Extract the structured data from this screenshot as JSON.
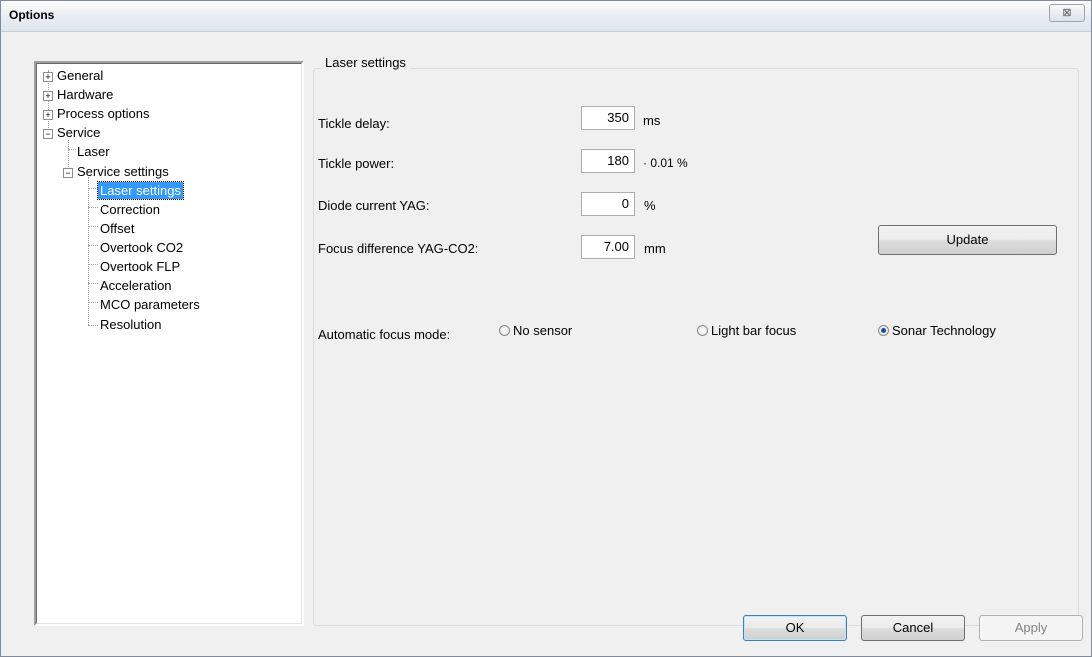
{
  "window": {
    "title": "Options",
    "close_glyph": "⊠"
  },
  "tree": {
    "nodes": [
      {
        "label": "General",
        "expander": "+"
      },
      {
        "label": "Hardware",
        "expander": "+"
      },
      {
        "label": "Process options",
        "expander": "+"
      },
      {
        "label": "Service",
        "expander": "−"
      },
      {
        "label": "Laser"
      },
      {
        "label": "Service settings",
        "expander": "−"
      },
      {
        "label": "Laser settings",
        "selected": true
      },
      {
        "label": "Correction"
      },
      {
        "label": "Offset"
      },
      {
        "label": "Overtook CO2"
      },
      {
        "label": "Overtook FLP"
      },
      {
        "label": "Acceleration"
      },
      {
        "label": "MCO parameters"
      },
      {
        "label": "Resolution"
      }
    ]
  },
  "panel": {
    "title": "Laser settings",
    "fields": [
      {
        "label": "Tickle delay:",
        "value": "350",
        "unit": "ms"
      },
      {
        "label": "Tickle power:",
        "value": "180",
        "unit": "· 0.01 %"
      },
      {
        "label": "Diode current YAG:",
        "value": "0",
        "unit": "%"
      },
      {
        "label": "Focus difference YAG-CO2:",
        "value": "7.00",
        "unit": "mm"
      }
    ],
    "update_label": "Update",
    "focus_mode_label": "Automatic focus mode:",
    "focus_options": [
      {
        "label": "No sensor",
        "checked": false
      },
      {
        "label": "Light bar focus",
        "checked": false
      },
      {
        "label": "Sonar Technology",
        "checked": true
      }
    ]
  },
  "footer": {
    "ok_label": "OK",
    "cancel_label": "Cancel",
    "apply_label": "Apply"
  }
}
